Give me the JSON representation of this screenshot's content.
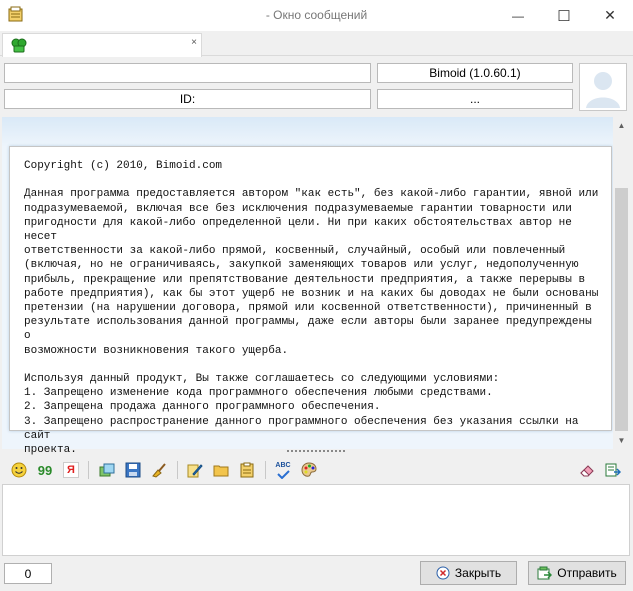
{
  "window": {
    "title": "- Окно сообщений",
    "minimize_glyph": "—",
    "maximize_glyph": "☐",
    "close_glyph": "✕"
  },
  "tab": {
    "close_glyph": "×"
  },
  "info": {
    "name_value": "",
    "client_label": "Bimoid (1.0.60.1)",
    "id_label": "ID:",
    "more_label": "..."
  },
  "message": {
    "text": "Copyright (c) 2010, Bimoid.com\n\nДанная программа предоставляется автором \"как есть\", без какой-либо гарантии, явной или\nподразумеваемой, включая все без исключения подразумеваемые гарантии товарности или\nпригодности для какой-либо определенной цели. Ни при каких обстоятельствах автор не несет\nответственности за какой-либо прямой, косвенный, случайный, особый или повлеченный\n(включая, но не ограничиваясь, закупкой заменяющих товаров или услуг, недополученную\nприбыль, прекращение или препятствование деятельности предприятия, а также перерывы в\nработе предприятия), как бы этот ущерб не возник и на каких бы доводах не были основаны\nпретензии (на нарушении договора, прямой или косвенной ответственности), причиненный в\nрезультате использования данной программы, даже если авторы были заранее предупреждены о\nвозможности возникновения такого ущерба.\n\nИспользуя данный продукт, Вы также соглашаетесь со следующими условиями:\n1. Запрещено изменение кода программного обеспечения любыми средствами.\n2. Запрещена продажа данного программного обеспечения.\n3. Запрещено распространение данного программного обеспечения без указания ссылки на сайт\nпроекта."
  },
  "toolbar": {
    "quote_glyph": "99",
    "yandex_glyph": "Я",
    "spell_glyph": "ABC"
  },
  "input": {
    "value": ""
  },
  "status": {
    "char_count": "0"
  },
  "buttons": {
    "close_label": "Закрыть",
    "send_label": "Отправить"
  }
}
